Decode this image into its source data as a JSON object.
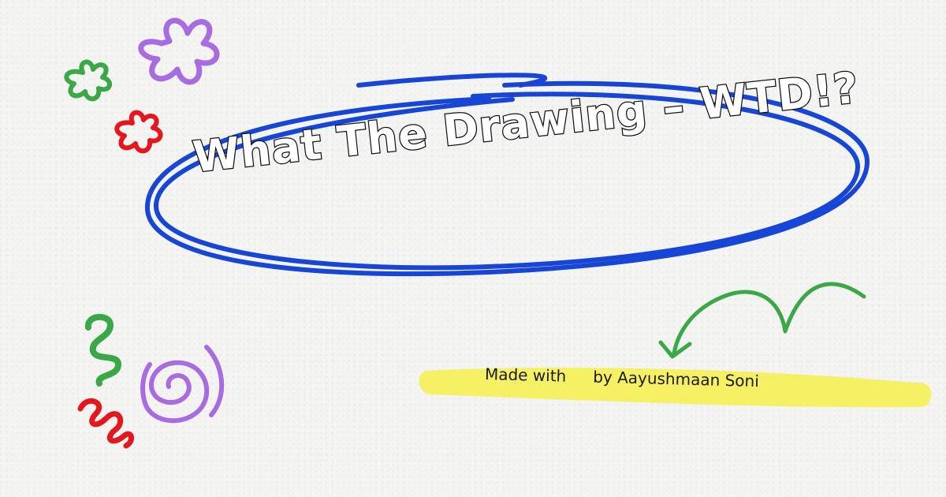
{
  "title": "What The Drawing – WTD!?",
  "credit": {
    "made_with": "Made with",
    "by": "by Aayushmaan Soni"
  },
  "colors": {
    "ellipse": "#1746d6",
    "highlight": "#f3f05a",
    "arrow": "#3aa846",
    "purple": "#a86be0",
    "green": "#3aa846",
    "red": "#e5161c"
  },
  "icons": [
    "purple-flower-icon",
    "green-flower-icon",
    "red-flower-icon",
    "green-squiggle-icon",
    "red-loop-icon",
    "purple-spiral-icon",
    "green-arrow-icon"
  ]
}
